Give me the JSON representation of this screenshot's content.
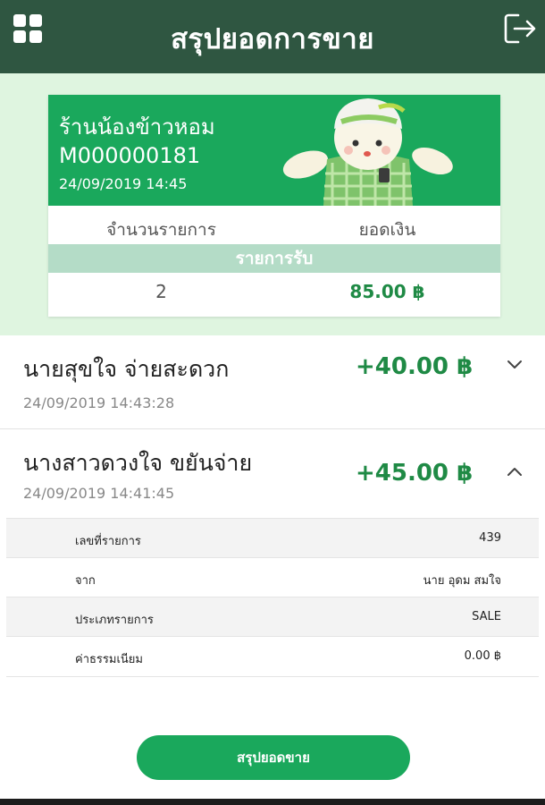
{
  "header": {
    "title": "สรุปยอดการขาย",
    "menu_icon": "grid-menu-icon",
    "logout_icon": "logout-icon"
  },
  "summary_card": {
    "shop_name": "ร้านน้องข้าวหอม",
    "merchant_id": "M000000181",
    "datetime": "24/09/2019 14:45",
    "col_count_label": "จำนวนรายการ",
    "col_amount_label": "ยอดเงิน",
    "section_label": "รายการรับ",
    "count_value": "2",
    "amount_value": "85.00 ฿"
  },
  "transactions": [
    {
      "name": "นายสุขใจ  จ่ายสะดวก",
      "datetime": "24/09/2019 14:43:28",
      "amount": "+40.00 ฿",
      "expanded": false
    },
    {
      "name": "นางสาวดวงใจ  ขยันจ่าย",
      "datetime": "24/09/2019 14:41:45",
      "amount": "+45.00 ฿",
      "expanded": true,
      "details": [
        {
          "label": "เลขที่รายการ",
          "value": "439"
        },
        {
          "label": "จาก",
          "value": "นาย อุดม สมใจ"
        },
        {
          "label": "ประเภทรายการ",
          "value": "SALE"
        },
        {
          "label": "ค่าธรรมเนียม",
          "value": "0.00 ฿"
        }
      ]
    }
  ],
  "footer": {
    "summary_button": "สรุปยอดขาย"
  },
  "colors": {
    "header_bg": "#2f5641",
    "primary_green": "#1aa85c",
    "amount_green": "#1f8a45",
    "page_tint": "#dff5e0",
    "band": "#b4dcc7"
  }
}
